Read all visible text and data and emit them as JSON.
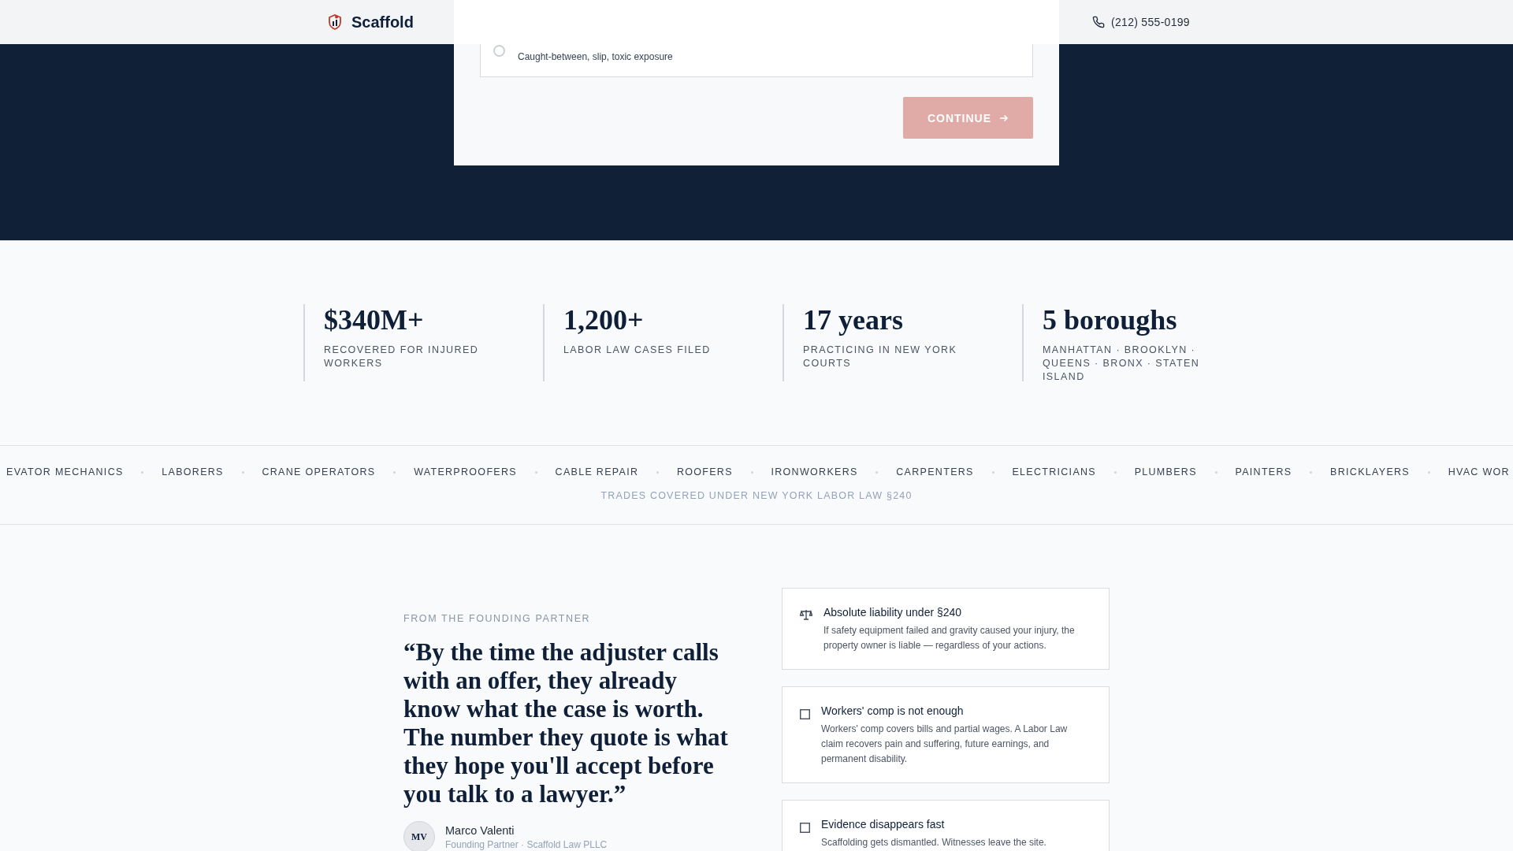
{
  "header": {
    "brand": "Scaffold",
    "phone": "(212) 555-0199"
  },
  "intake": {
    "option": {
      "subtitle": "Caught-between, slip, toxic exposure",
      "selected": false
    },
    "continue_button": "CONTINUE",
    "disabled": true
  },
  "stats": [
    {
      "value": "$340M+",
      "label": "RECOVERED FOR INJURED WORKERS"
    },
    {
      "value": "1,200+",
      "label": "LABOR LAW CASES FILED"
    },
    {
      "value": "17 years",
      "label": "PRACTICING IN NEW YORK COURTS"
    },
    {
      "value": "5 boroughs",
      "label": "MANHATTAN · BROOKLYN · QUEENS · BRONX · STATEN ISLAND"
    }
  ],
  "trades": {
    "items": [
      "EVATOR MECHANICS",
      "LABORERS",
      "CRANE OPERATORS",
      "WATERPROOFERS",
      "CABLE REPAIR",
      "ROOFERS",
      "IRONWORKERS",
      "CARPENTERS",
      "ELECTRICIANS",
      "PLUMBERS",
      "PAINTERS",
      "BRICKLAYERS",
      "HVAC WOR"
    ],
    "caption": "TRADES COVERED UNDER NEW YORK LABOR LAW §240"
  },
  "testimonial": {
    "eyebrow": "FROM THE FOUNDING PARTNER",
    "quote": "“By the time the adjuster calls with an offer, they already know what the case is worth. The number they quote is what they hope you'll accept before you talk to a lawyer.”",
    "avatar": "MV",
    "name": "Marco Valenti",
    "role": "Founding Partner · Scaffold Law PLLC"
  },
  "reasons": [
    {
      "kind": "scales",
      "title": "Absolute liability under §240",
      "text": "If safety equipment failed and gravity caused your injury, the property owner is liable — regardless of your actions."
    },
    {
      "kind": "square",
      "title": "Workers' comp is not enough",
      "text": "Workers' comp covers bills and partial wages. A Labor Law claim recovers pain and suffering, future earnings, and permanent disability."
    },
    {
      "kind": "square",
      "title": "Evidence disappears fast",
      "text": "Scaffolding gets dismantled. Witnesses leave the site."
    }
  ]
}
